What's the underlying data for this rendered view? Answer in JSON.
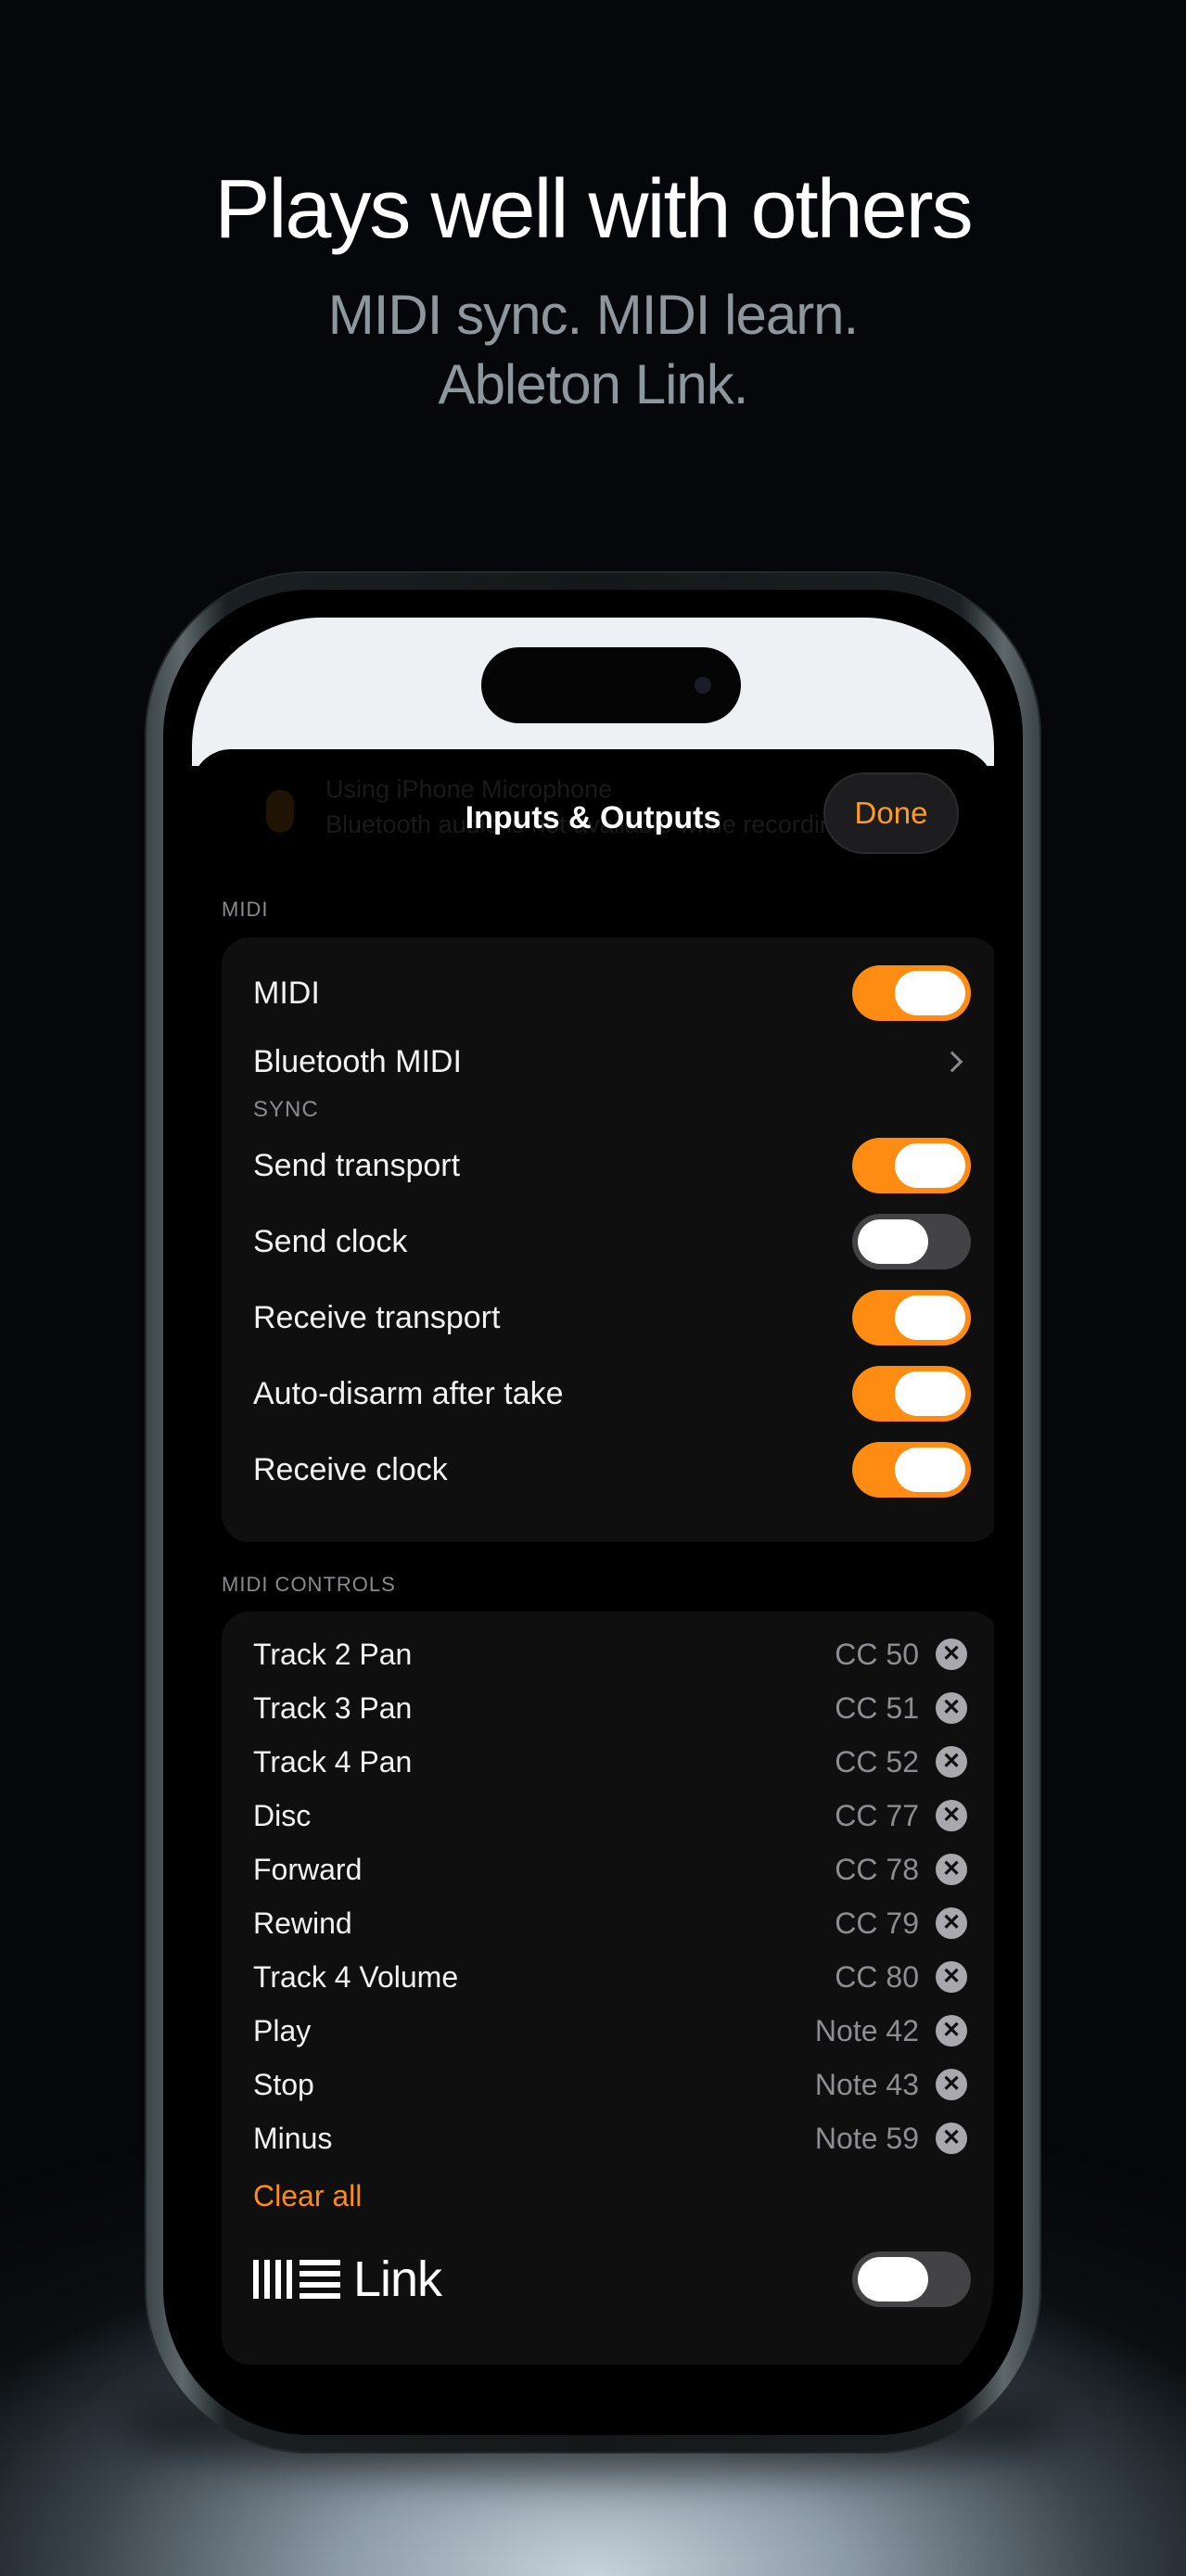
{
  "hero": {
    "headline": "Plays well with others",
    "subline_1": "MIDI sync. MIDI learn.",
    "subline_2": "Ableton Link."
  },
  "banner": {
    "line_1": "Using iPhone Microphone",
    "line_2": "Bluetooth audio is not available while recording"
  },
  "header": {
    "title": "Inputs & Outputs",
    "done_label": "Done"
  },
  "midi_section": {
    "label": "MIDI",
    "midi_label": "MIDI",
    "midi_on": true,
    "bluetooth_label": "Bluetooth MIDI",
    "sync_label": "SYNC",
    "sync_rows": [
      {
        "label": "Send transport",
        "on": true
      },
      {
        "label": "Send clock",
        "on": false
      },
      {
        "label": "Receive transport",
        "on": true
      },
      {
        "label": "Auto-disarm after take",
        "on": true
      },
      {
        "label": "Receive clock",
        "on": true
      }
    ]
  },
  "controls_section": {
    "label": "MIDI CONTROLS",
    "items": [
      {
        "name": "Track 2 Pan",
        "value": "CC 50"
      },
      {
        "name": "Track 3 Pan",
        "value": "CC 51"
      },
      {
        "name": "Track 4 Pan",
        "value": "CC 52"
      },
      {
        "name": "Disc",
        "value": "CC 77"
      },
      {
        "name": "Forward",
        "value": "CC 78"
      },
      {
        "name": "Rewind",
        "value": "CC 79"
      },
      {
        "name": "Track 4 Volume",
        "value": "CC 80"
      },
      {
        "name": "Play",
        "value": "Note 42"
      },
      {
        "name": "Stop",
        "value": "Note 43"
      },
      {
        "name": "Minus",
        "value": "Note 59"
      }
    ],
    "remove_glyph": "✕",
    "clear_all_label": "Clear all",
    "link_label": "Link",
    "link_on": false
  },
  "colors": {
    "accent": "#ff8c12",
    "toggle_off": "#434345"
  }
}
